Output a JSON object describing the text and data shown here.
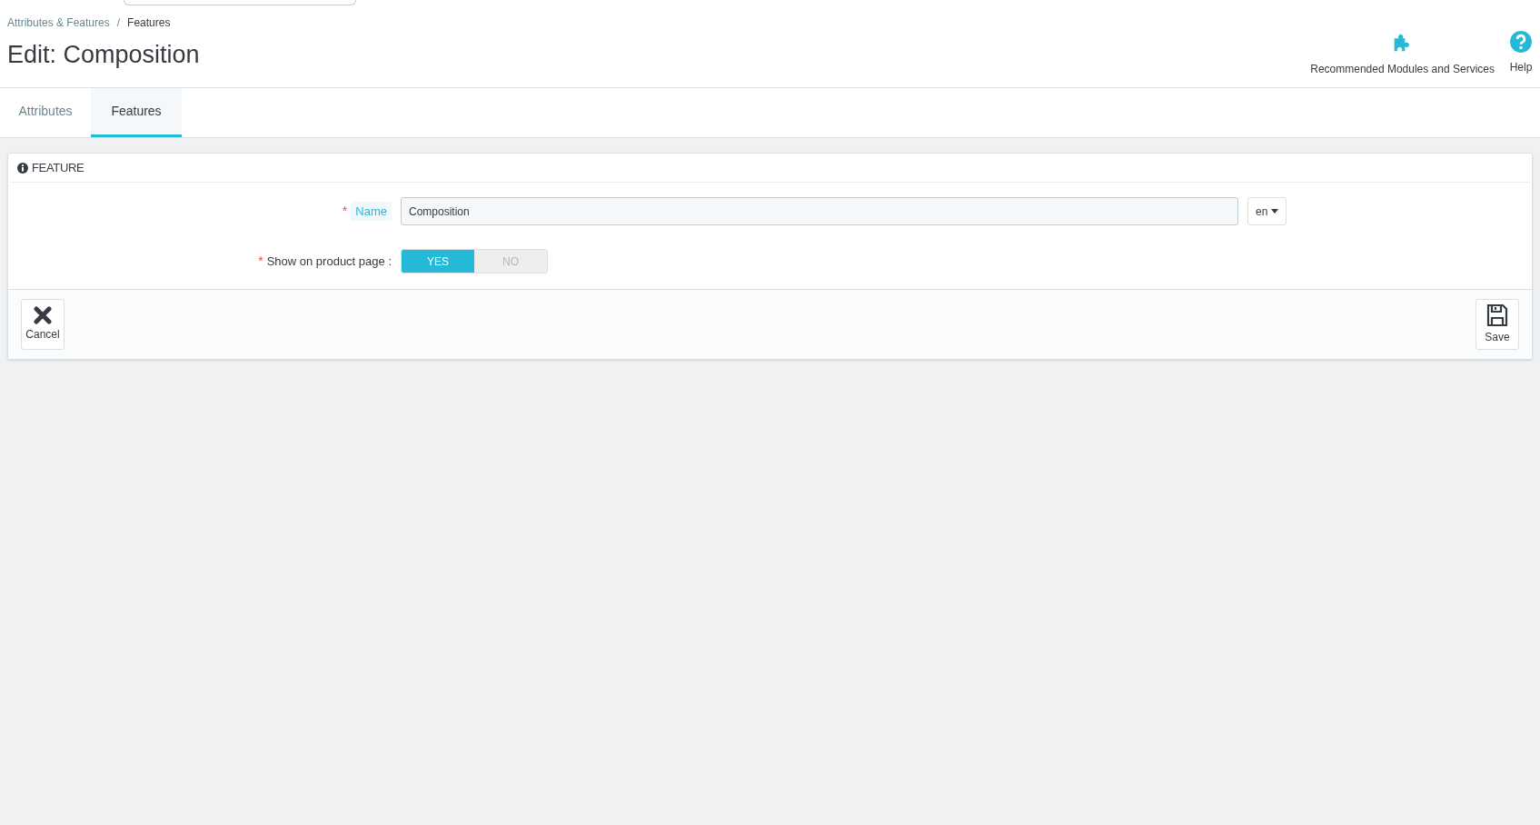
{
  "breadcrumb": [
    {
      "label": "Attributes & Features"
    },
    {
      "separator": "/",
      "label": "Features"
    }
  ],
  "title": "Edit: Composition",
  "toolbar": [
    {
      "kind": "modules",
      "label": "Recommended Modules and Services"
    },
    {
      "kind": "help",
      "label": "Help"
    }
  ],
  "tabs": [
    {
      "label": "Attributes",
      "selected": false
    },
    {
      "label": "Features",
      "selected": true
    }
  ],
  "panel": {
    "heading": "FEATURE",
    "name_field": {
      "label": "Name",
      "required_mark": "*",
      "value": "Composition",
      "language": "en"
    },
    "show_on_product_page": {
      "label": "Show on product page :",
      "required_mark": "*",
      "options": [
        {
          "label": "YES",
          "selected": true
        },
        {
          "label": "NO",
          "selected": false
        }
      ]
    },
    "buttons": [
      {
        "kind": "cancel",
        "label": "Cancel"
      },
      {
        "kind": "save",
        "label": "Save"
      }
    ]
  }
}
